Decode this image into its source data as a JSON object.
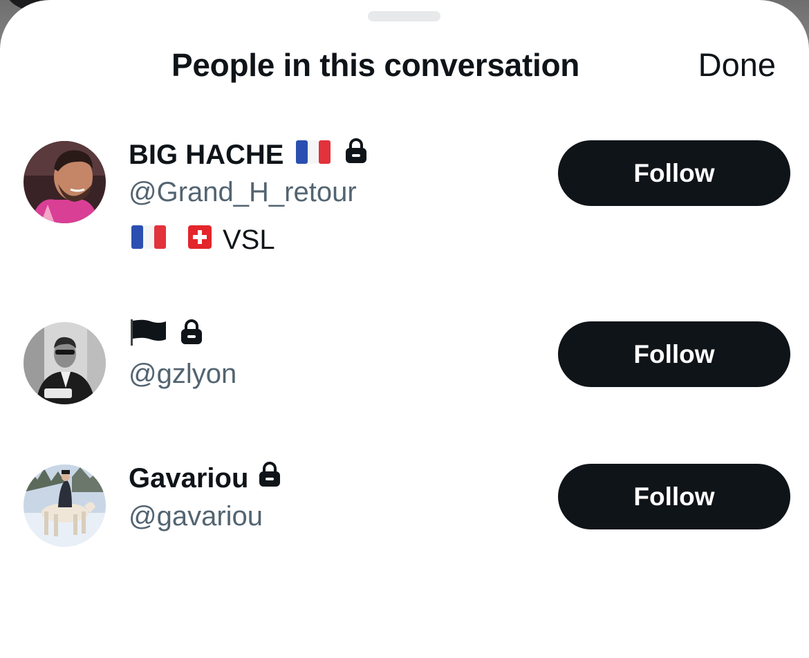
{
  "sheet": {
    "title": "People in this conversation",
    "done_label": "Done"
  },
  "people": [
    {
      "name": "BIG HACHE",
      "name_icons": [
        "france-flag-icon",
        "lock-icon"
      ],
      "handle": "@Grand_H_retour",
      "bio_icons": [
        "france-flag-icon",
        "switzerland-flag-icon"
      ],
      "bio_text": "VSL",
      "follow_label": "Follow"
    },
    {
      "name": "",
      "name_icons": [
        "black-flag-icon",
        "lock-icon"
      ],
      "handle": "@gzlyon",
      "follow_label": "Follow"
    },
    {
      "name": "Gavariou",
      "name_icons": [
        "lock-icon"
      ],
      "handle": "@gavariou",
      "follow_label": "Follow"
    }
  ],
  "colors": {
    "primary_text": "#0f1419",
    "secondary_text": "#536471",
    "button_bg": "#0f1419",
    "button_text": "#ffffff"
  }
}
